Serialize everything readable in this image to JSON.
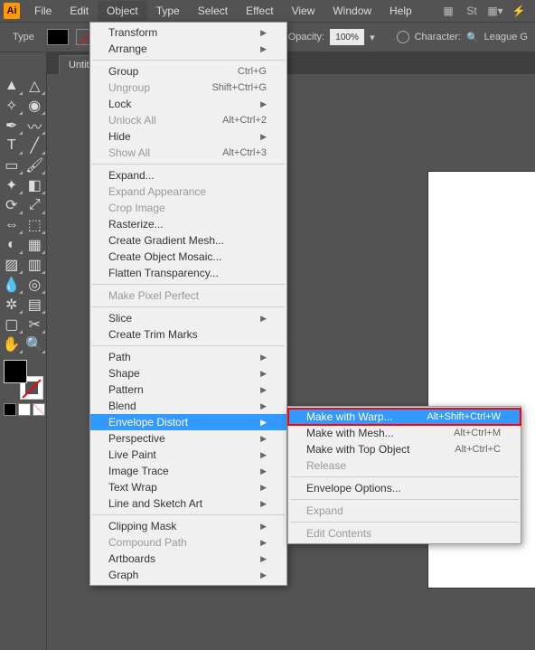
{
  "app_icon": "Ai",
  "menubar": [
    "File",
    "Edit",
    "Object",
    "Type",
    "Select",
    "Effect",
    "View",
    "Window",
    "Help"
  ],
  "options": {
    "type_label": "Type",
    "opacity_label": "Opacity:",
    "opacity_value": "100%",
    "character_label": "Character:",
    "search_placeholder": "League G"
  },
  "doc_tab": "Untitl",
  "object_menu": [
    {
      "label": "Transform",
      "arrow": true
    },
    {
      "label": "Arrange",
      "arrow": true
    },
    {
      "sep": true
    },
    {
      "label": "Group",
      "shortcut": "Ctrl+G"
    },
    {
      "label": "Ungroup",
      "shortcut": "Shift+Ctrl+G",
      "disabled": true
    },
    {
      "label": "Lock",
      "arrow": true
    },
    {
      "label": "Unlock All",
      "shortcut": "Alt+Ctrl+2",
      "disabled": true
    },
    {
      "label": "Hide",
      "arrow": true
    },
    {
      "label": "Show All",
      "shortcut": "Alt+Ctrl+3",
      "disabled": true
    },
    {
      "sep": true
    },
    {
      "label": "Expand..."
    },
    {
      "label": "Expand Appearance",
      "disabled": true
    },
    {
      "label": "Crop Image",
      "disabled": true
    },
    {
      "label": "Rasterize..."
    },
    {
      "label": "Create Gradient Mesh..."
    },
    {
      "label": "Create Object Mosaic..."
    },
    {
      "label": "Flatten Transparency..."
    },
    {
      "sep": true
    },
    {
      "label": "Make Pixel Perfect",
      "disabled": true
    },
    {
      "sep": true
    },
    {
      "label": "Slice",
      "arrow": true
    },
    {
      "label": "Create Trim Marks"
    },
    {
      "sep": true
    },
    {
      "label": "Path",
      "arrow": true
    },
    {
      "label": "Shape",
      "arrow": true
    },
    {
      "label": "Pattern",
      "arrow": true
    },
    {
      "label": "Blend",
      "arrow": true
    },
    {
      "label": "Envelope Distort",
      "arrow": true,
      "highlight": true
    },
    {
      "label": "Perspective",
      "arrow": true
    },
    {
      "label": "Live Paint",
      "arrow": true
    },
    {
      "label": "Image Trace",
      "arrow": true
    },
    {
      "label": "Text Wrap",
      "arrow": true
    },
    {
      "label": "Line and Sketch Art",
      "arrow": true
    },
    {
      "sep": true
    },
    {
      "label": "Clipping Mask",
      "arrow": true
    },
    {
      "label": "Compound Path",
      "arrow": true,
      "disabled": true
    },
    {
      "label": "Artboards",
      "arrow": true
    },
    {
      "label": "Graph",
      "arrow": true
    }
  ],
  "submenu": [
    {
      "label": "Make with Warp...",
      "shortcut": "Alt+Shift+Ctrl+W",
      "highlight": true,
      "redbox": true
    },
    {
      "label": "Make with Mesh...",
      "shortcut": "Alt+Ctrl+M"
    },
    {
      "label": "Make with Top Object",
      "shortcut": "Alt+Ctrl+C"
    },
    {
      "label": "Release",
      "disabled": true
    },
    {
      "sep": true
    },
    {
      "label": "Envelope Options..."
    },
    {
      "sep": true
    },
    {
      "label": "Expand",
      "disabled": true
    },
    {
      "sep": true
    },
    {
      "label": "Edit Contents",
      "disabled": true
    }
  ],
  "tools": [
    [
      "selection",
      "direct-selection"
    ],
    [
      "magic-wand",
      "lasso"
    ],
    [
      "pen",
      "curvature"
    ],
    [
      "type",
      "line"
    ],
    [
      "rectangle",
      "paintbrush"
    ],
    [
      "shaper",
      "eraser"
    ],
    [
      "rotate",
      "scale"
    ],
    [
      "width",
      "free-transform"
    ],
    [
      "shape-builder",
      "perspective"
    ],
    [
      "mesh",
      "gradient"
    ],
    [
      "eyedropper",
      "blend"
    ],
    [
      "symbol-sprayer",
      "graph"
    ],
    [
      "artboard",
      "slice"
    ],
    [
      "hand",
      "zoom"
    ]
  ]
}
